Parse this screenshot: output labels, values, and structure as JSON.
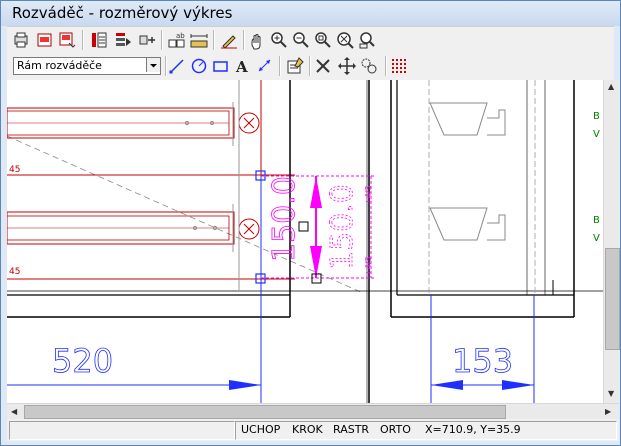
{
  "window": {
    "title": "Rozváděč - rozměrový výkres"
  },
  "toolbar": {
    "layer_select": {
      "value": "Rám rozváděče"
    },
    "row1_icons": [
      "print-icon",
      "print-preview-icon",
      "page-setup-icon",
      "text-block-icon",
      "layers-icon",
      "move-icon",
      "grid-text-icon",
      "measure-icon",
      "edit-pencil-icon",
      "hand-pan-icon",
      "zoom-in-icon",
      "zoom-out-icon",
      "zoom-window-icon",
      "zoom-all-icon",
      "zoom-previous-icon"
    ],
    "row2_icons": [
      "line-icon",
      "circle-icon",
      "rectangle-icon",
      "text-icon",
      "dimension-icon",
      "properties-icon",
      "delete-icon",
      "move-cross-icon",
      "copy-icon",
      "grid-dots-icon"
    ]
  },
  "drawing": {
    "dimensions": [
      "520",
      "153",
      "150.0",
      "150.0"
    ],
    "labels": [
      "45",
      "45",
      "B",
      "V",
      "B",
      "V"
    ]
  },
  "statusbar": {
    "cells": [
      "UCHOP",
      "KROK",
      "RASTR",
      "ORTO"
    ],
    "coords": "X=710.9, Y=35.9"
  },
  "colors": {
    "drawing_blue": "#1f2fff",
    "drawing_red": "#c00000",
    "drawing_magenta": "#ff00ff",
    "drawing_green": "#008000"
  }
}
